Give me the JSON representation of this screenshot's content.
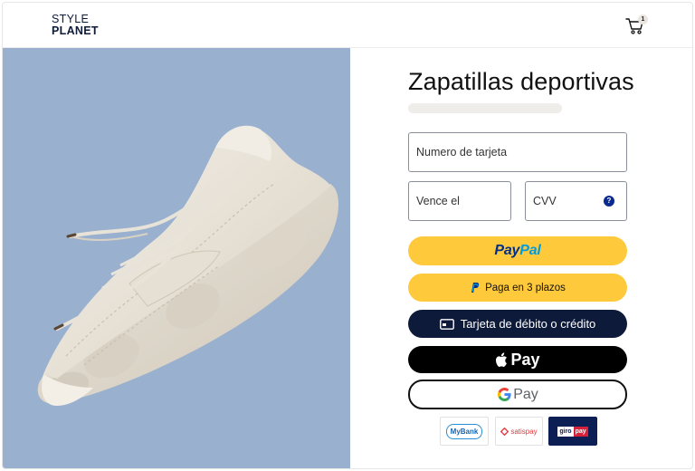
{
  "header": {
    "logo_line1": "STYLE",
    "logo_line2": "PLANET",
    "cart_icon": "cart-icon",
    "cart_count": "1"
  },
  "product": {
    "title": "Zapatillas deportivas",
    "image": "white-sneaker-image",
    "panel_color": "#9ab0cf"
  },
  "form": {
    "card_number_placeholder": "Numero de tarjeta",
    "expiry_placeholder": "Vence el",
    "cvv_placeholder": "CVV",
    "cvv_help_icon": "?"
  },
  "payment_buttons": {
    "paypal_part1": "Pay",
    "paypal_part2": "Pal",
    "paylater_label": "Paga en 3 plazos",
    "card_label": "Tarjeta de débito o crédito",
    "applepay_label": "Pay",
    "googlepay_label": "Pay"
  },
  "payment_badges": {
    "mybank": "MyBank",
    "satispay": "satispay",
    "giropay_a": "giro",
    "giropay_b": "pay"
  },
  "colors": {
    "accent_yellow": "#ffc93c",
    "navy": "#0e1a3a",
    "black": "#000000"
  }
}
